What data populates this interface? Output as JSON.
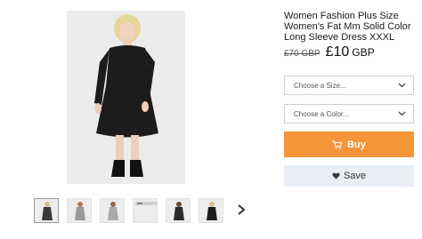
{
  "product": {
    "title": "Women Fashion Plus Size Women's Fat Mm Solid Color Long Sleeve Dress XXXL",
    "old_price": "£70 GBP",
    "price": "£10",
    "currency": "GBP"
  },
  "options": {
    "size_placeholder": "Choose a Size...",
    "color_placeholder": "Choose a Color..."
  },
  "actions": {
    "buy_label": "Buy",
    "save_label": "Save"
  },
  "colors": {
    "accent": "#f6943a",
    "save_bg": "#e8eef4",
    "dress": "#1c1c1c"
  },
  "icons": {
    "buy": "cart-icon",
    "save": "heart-icon",
    "next": "chevron-right-icon",
    "select": "chevron-down-icon"
  },
  "gallery": {
    "thumbnail_count": 6
  }
}
